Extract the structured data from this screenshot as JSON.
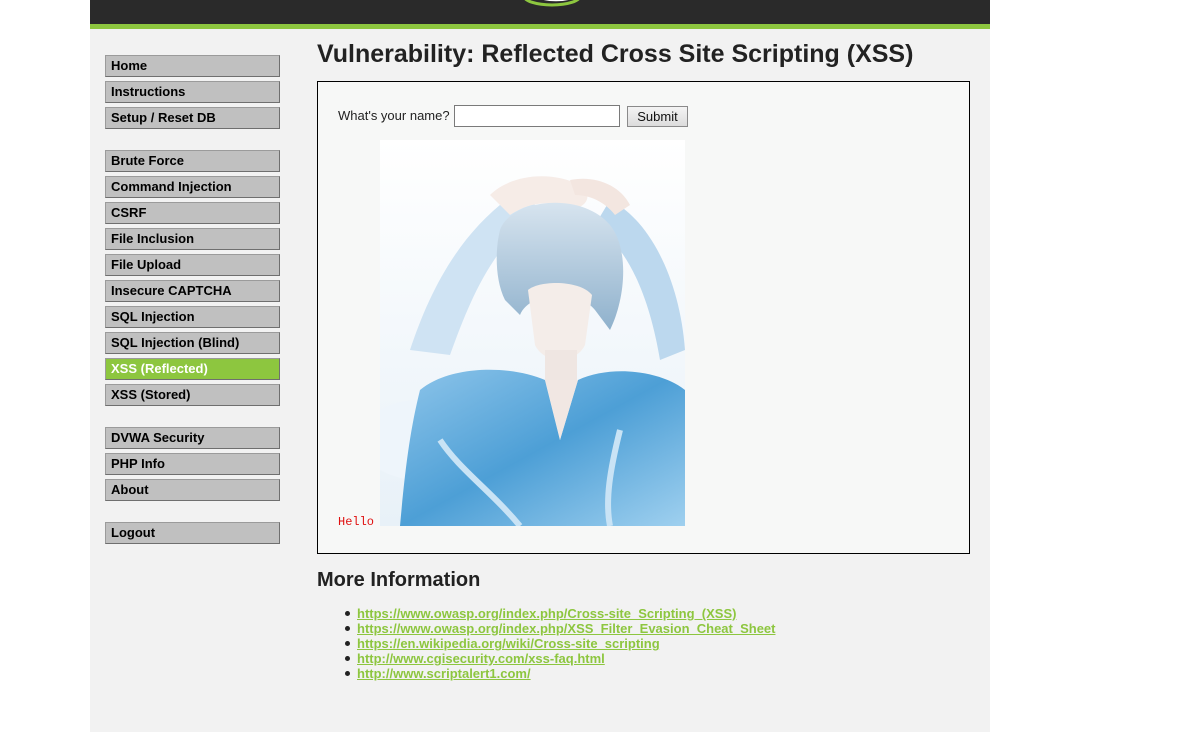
{
  "menu": {
    "group1": [
      {
        "label": "Home"
      },
      {
        "label": "Instructions"
      },
      {
        "label": "Setup / Reset DB"
      }
    ],
    "group2": [
      {
        "label": "Brute Force"
      },
      {
        "label": "Command Injection"
      },
      {
        "label": "CSRF"
      },
      {
        "label": "File Inclusion"
      },
      {
        "label": "File Upload"
      },
      {
        "label": "Insecure CAPTCHA"
      },
      {
        "label": "SQL Injection"
      },
      {
        "label": "SQL Injection (Blind)"
      },
      {
        "label": "XSS (Reflected)",
        "selected": true
      },
      {
        "label": "XSS (Stored)"
      }
    ],
    "group3": [
      {
        "label": "DVWA Security"
      },
      {
        "label": "PHP Info"
      },
      {
        "label": "About"
      }
    ],
    "group4": [
      {
        "label": "Logout"
      }
    ]
  },
  "main": {
    "title": "Vulnerability: Reflected Cross Site Scripting (XSS)",
    "form": {
      "label": "What's your name?",
      "input_value": "",
      "submit_label": "Submit"
    },
    "output_text": "Hello",
    "more_info_title": "More Information",
    "links": [
      "https://www.owasp.org/index.php/Cross-site_Scripting_(XSS)",
      "https://www.owasp.org/index.php/XSS_Filter_Evasion_Cheat_Sheet",
      "https://en.wikipedia.org/wiki/Cross-site_scripting",
      "http://www.cgisecurity.com/xss-faq.html",
      "http://www.scriptalert1.com/"
    ]
  },
  "colors": {
    "accent": "#8dc63f",
    "header_bg": "#2a2a2a",
    "menu_bg": "#c0c0c0",
    "page_bg": "#f2f2f2",
    "hello_red": "#e01010"
  }
}
